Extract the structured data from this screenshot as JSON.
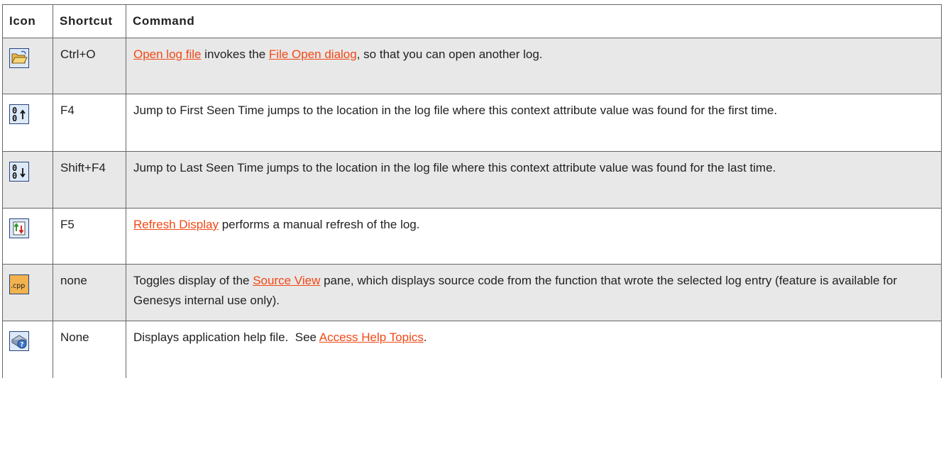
{
  "table": {
    "headers": {
      "icon": "Icon",
      "shortcut": "Shortcut",
      "command": "Command"
    },
    "rows": [
      {
        "icon": "open-folder-icon",
        "shortcut": "Ctrl+O",
        "parts": [
          {
            "text": "Open log file",
            "link": true
          },
          {
            "text": " invokes the ",
            "link": false
          },
          {
            "text": "File Open dialog",
            "link": true
          },
          {
            "text": ", so that you can open another log.",
            "link": false
          }
        ]
      },
      {
        "icon": "jump-first-seen-icon",
        "shortcut": "F4",
        "parts": [
          {
            "text": "Jump to First Seen Time jumps to the location in the log file where this context attribute value was found for the first time.",
            "link": false
          }
        ]
      },
      {
        "icon": "jump-last-seen-icon",
        "shortcut": "Shift+F4",
        "parts": [
          {
            "text": "Jump to Last Seen Time jumps to the location in the log file where this context attribute value was found for the last time.",
            "link": false
          }
        ]
      },
      {
        "icon": "refresh-icon",
        "shortcut": "F5",
        "parts": [
          {
            "text": "Refresh Display",
            "link": true
          },
          {
            "text": " performs a manual refresh of the log.",
            "link": false
          }
        ]
      },
      {
        "icon": "cpp-source-icon",
        "shortcut": "none",
        "parts": [
          {
            "text": "Toggles display of the ",
            "link": false
          },
          {
            "text": "Source View",
            "link": true
          },
          {
            "text": " pane, which displays source code from the function that wrote the selected log entry (feature is available for Genesys internal use only).",
            "link": false
          }
        ]
      },
      {
        "icon": "help-book-icon",
        "shortcut": "None",
        "parts": [
          {
            "text": "Displays application help file.  See ",
            "link": false
          },
          {
            "text": "Access Help Topics",
            "link": true
          },
          {
            "text": ".",
            "link": false
          }
        ]
      }
    ]
  },
  "colors": {
    "link": "#f24815",
    "row_shade": "#e8e8e8",
    "border": "#666666"
  }
}
